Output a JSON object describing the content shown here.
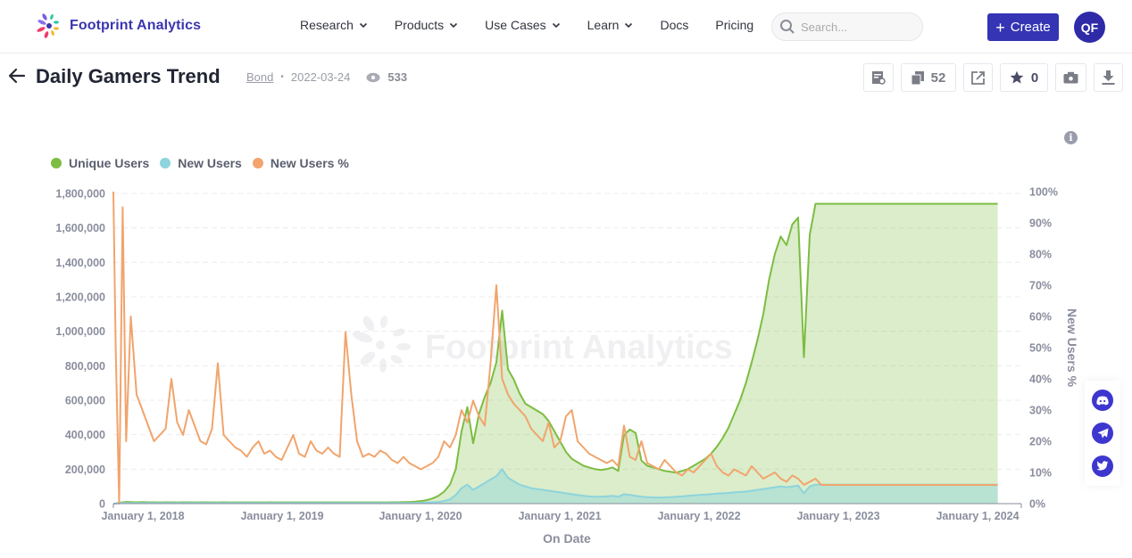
{
  "brand": {
    "name": "Footprint Analytics"
  },
  "nav": {
    "items": [
      {
        "label": "Research",
        "dropdown": true
      },
      {
        "label": "Products",
        "dropdown": true
      },
      {
        "label": "Use Cases",
        "dropdown": true
      },
      {
        "label": "Learn",
        "dropdown": true
      },
      {
        "label": "Docs",
        "dropdown": false
      },
      {
        "label": "Pricing",
        "dropdown": false
      }
    ],
    "search_placeholder": "Search...",
    "create_label": "Create",
    "avatar_initials": "QF"
  },
  "page": {
    "title": "Daily Gamers Trend",
    "author": "Bond",
    "date": "2022-03-24",
    "views": "533",
    "copies_count": "52",
    "stars_count": "0"
  },
  "colors": {
    "brand": "#3434b4",
    "unique_users": "#7cbd42",
    "new_users": "#8dd4dc",
    "new_users_pct": "#f1a46c"
  },
  "chart_data": {
    "type": "line",
    "title": "",
    "xlabel": "On Date",
    "ylabel": "",
    "y2label": "New Users %",
    "watermark": "Footprint Analytics",
    "legend_position": "top-left",
    "grid": true,
    "x_ticks": [
      "January 1, 2018",
      "January 1, 2019",
      "January 1, 2020",
      "January 1, 2021",
      "January 1, 2022",
      "January 1, 2023",
      "January 1, 2024"
    ],
    "y_ticks": [
      "0",
      "200,000",
      "400,000",
      "600,000",
      "800,000",
      "1,000,000",
      "1,200,000",
      "1,400,000",
      "1,600,000",
      "1,800,000"
    ],
    "y2_ticks": [
      "0%",
      "10%",
      "20%",
      "30%",
      "40%",
      "50%",
      "60%",
      "70%",
      "80%",
      "90%",
      "100%"
    ],
    "ylim": [
      0,
      1800000
    ],
    "y2lim": [
      0,
      100
    ],
    "x_range": [
      "2017-12-25",
      "2024-03-10"
    ],
    "x_unit": "months since 2018-01-01",
    "x": [
      -0.2,
      0.2,
      0.5,
      0.8,
      1.1,
      1.5,
      2,
      2.5,
      3,
      3.5,
      4,
      4.5,
      5,
      5.5,
      6,
      6.5,
      7,
      7.5,
      8,
      8.5,
      9,
      9.5,
      10,
      10.5,
      11,
      11.5,
      12,
      12.5,
      13,
      13.5,
      14,
      14.5,
      15,
      15.5,
      16,
      16.5,
      17,
      17.5,
      18,
      18.5,
      19,
      19.5,
      20,
      20.5,
      21,
      21.5,
      22,
      22.5,
      23,
      23.5,
      24,
      24.5,
      25,
      25.5,
      26,
      26.5,
      27,
      27.5,
      28,
      28.5,
      29,
      29.5,
      30,
      30.5,
      31,
      31.5,
      32,
      32.5,
      33,
      33.5,
      34,
      34.5,
      35,
      35.5,
      36,
      36.5,
      37,
      37.5,
      38,
      38.5,
      39,
      39.5,
      40,
      40.5,
      41,
      41.5,
      42,
      42.5,
      43,
      43.5,
      44,
      44.5,
      45,
      45.5,
      46,
      46.5,
      47,
      47.5,
      48,
      48.5,
      49,
      49.5,
      50,
      50.5,
      51,
      51.5,
      52,
      52.5,
      53,
      53.5,
      54,
      54.5,
      55,
      55.5,
      56,
      56.5,
      57,
      57.5,
      58,
      58.5,
      59,
      59.5,
      60,
      60.5,
      61,
      61.5,
      62,
      62.5,
      63,
      63.5,
      64,
      64.5,
      65,
      65.5,
      66,
      66.5,
      67,
      67.5,
      68,
      68.5,
      69,
      69.5,
      70,
      70.5,
      71,
      71.5,
      72,
      72.5,
      73,
      73.5,
      74,
      74.5,
      75,
      75.3,
      75.6,
      75.9,
      76.2
    ],
    "series": [
      {
        "name": "Unique Users",
        "type": "area",
        "axis": "left",
        "values": [
          0,
          0,
          5000,
          8000,
          10000,
          9000,
          8000,
          9000,
          8000,
          8000,
          7000,
          8000,
          8000,
          7000,
          8000,
          8000,
          7000,
          8000,
          8000,
          7000,
          7000,
          8000,
          7000,
          7000,
          7000,
          7000,
          7000,
          7000,
          7000,
          8000,
          7000,
          7000,
          7000,
          7000,
          7000,
          7000,
          7000,
          7000,
          7000,
          7000,
          7000,
          7000,
          7000,
          7000,
          7000,
          7000,
          7000,
          7000,
          7000,
          7000,
          8000,
          8000,
          9000,
          10000,
          12000,
          15000,
          20000,
          30000,
          45000,
          70000,
          110000,
          200000,
          420000,
          560000,
          350000,
          520000,
          620000,
          700000,
          820000,
          1120000,
          780000,
          720000,
          640000,
          580000,
          560000,
          540000,
          520000,
          480000,
          420000,
          360000,
          300000,
          260000,
          240000,
          220000,
          210000,
          200000,
          195000,
          200000,
          210000,
          190000,
          400000,
          430000,
          410000,
          250000,
          220000,
          210000,
          200000,
          190000,
          185000,
          180000,
          190000,
          200000,
          220000,
          240000,
          260000,
          290000,
          330000,
          380000,
          440000,
          520000,
          600000,
          700000,
          820000,
          950000,
          1100000,
          1300000,
          1450000,
          1550000,
          1500000,
          1620000,
          1660000,
          850000,
          1560000,
          1740000
        ],
        "x_offset_note": "values trimmed to match x length"
      },
      {
        "name": "New Users",
        "type": "area",
        "axis": "left",
        "values": [
          0,
          0,
          3000,
          3000,
          3000,
          3000,
          3000,
          3000,
          3000,
          3000,
          3000,
          3000,
          3000,
          3000,
          3000,
          3000,
          3000,
          3000,
          3000,
          3000,
          3000,
          3000,
          3000,
          3000,
          3000,
          3000,
          3000,
          3000,
          3000,
          3000,
          3000,
          3000,
          3000,
          3000,
          3000,
          3000,
          3000,
          3000,
          3000,
          3000,
          3000,
          3000,
          3000,
          3000,
          3000,
          3000,
          3000,
          3000,
          3000,
          3000,
          3000,
          3000,
          3000,
          3000,
          4000,
          5000,
          6000,
          8000,
          10000,
          15000,
          25000,
          50000,
          90000,
          110000,
          80000,
          100000,
          120000,
          140000,
          160000,
          200000,
          150000,
          130000,
          110000,
          100000,
          90000,
          85000,
          80000,
          75000,
          70000,
          65000,
          60000,
          55000,
          50000,
          45000,
          42000,
          40000,
          40000,
          42000,
          45000,
          40000,
          55000,
          50000,
          45000,
          40000,
          38000,
          36000,
          35000,
          36000,
          38000,
          40000,
          42000,
          45000,
          48000,
          50000,
          52000,
          55000,
          58000,
          60000,
          62000,
          65000,
          68000,
          70000,
          75000,
          80000,
          85000,
          90000,
          95000,
          100000,
          95000,
          100000,
          105000,
          60000,
          100000,
          110000
        ]
      },
      {
        "name": "New Users %",
        "type": "line",
        "axis": "right",
        "values": [
          100,
          50,
          0,
          95,
          20,
          60,
          35,
          30,
          25,
          20,
          22,
          24,
          40,
          26,
          22,
          30,
          25,
          20,
          19,
          24,
          45,
          22,
          20,
          18,
          17,
          15,
          18,
          20,
          16,
          17,
          15,
          14,
          18,
          22,
          16,
          15,
          20,
          17,
          16,
          18,
          16,
          15,
          55,
          35,
          20,
          15,
          16,
          15,
          17,
          16,
          14,
          13,
          15,
          13,
          12,
          11,
          12,
          13,
          15,
          20,
          18,
          22,
          30,
          26,
          33,
          28,
          25,
          45,
          70,
          40,
          35,
          32,
          30,
          28,
          24,
          22,
          20,
          26,
          18,
          20,
          28,
          30,
          20,
          18,
          16,
          15,
          14,
          13,
          14,
          12,
          25,
          15,
          14,
          20,
          13,
          12,
          11,
          14,
          12,
          10,
          9,
          11,
          10,
          12,
          14,
          16,
          12,
          10,
          9,
          11,
          10,
          9,
          12,
          10,
          8,
          9,
          10,
          8,
          7,
          9,
          8,
          6,
          7,
          8,
          6
        ]
      }
    ]
  },
  "social": {
    "items": [
      {
        "name": "discord"
      },
      {
        "name": "telegram"
      },
      {
        "name": "twitter"
      }
    ]
  }
}
